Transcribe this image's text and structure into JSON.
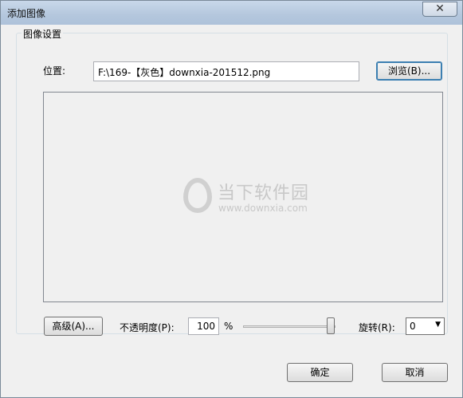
{
  "window": {
    "title": "添加图像",
    "close_glyph": "✕"
  },
  "group": {
    "title": "图像设置"
  },
  "location": {
    "label": "位置:",
    "value": "F:\\169-【灰色】downxia-201512.png",
    "browse_label": "浏览(B)..."
  },
  "preview": {
    "watermark_main": "当下软件园",
    "watermark_sub": "www.downxia.com"
  },
  "controls": {
    "advanced_label": "高级(A)...",
    "opacity_label": "不透明度(P):",
    "opacity_value": "100",
    "opacity_unit": "%",
    "opacity_slider": 1.0,
    "rotate_label": "旋转(R):",
    "rotate_value": "0"
  },
  "footer": {
    "ok_label": "确定",
    "cancel_label": "取消"
  },
  "icons": {
    "close": "close-icon",
    "dropdown": "chevron-down-icon",
    "watermark_logo": "downxia-logo-icon"
  }
}
